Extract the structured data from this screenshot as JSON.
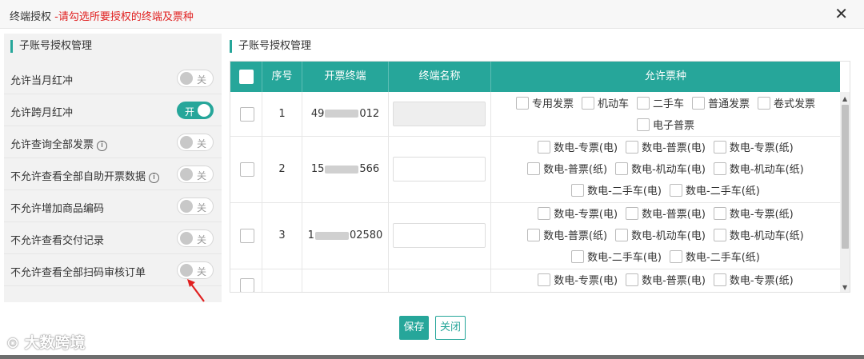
{
  "dialog": {
    "title": "终端授权",
    "hint": " -请勾选所要授权的终端及票种"
  },
  "left": {
    "section_title": "子账号授权管理",
    "options": [
      {
        "label": "允许当月红冲",
        "toggle": "关",
        "on": false
      },
      {
        "label": "允许跨月红冲",
        "toggle": "开",
        "on": true
      },
      {
        "label": "允许查询全部发票",
        "toggle": "关",
        "on": false,
        "info": "i"
      },
      {
        "label": "不允许查看全部自助开票数据",
        "toggle": "关",
        "on": false,
        "info": "i"
      },
      {
        "label": "不允许增加商品编码",
        "toggle": "关",
        "on": false
      },
      {
        "label": "不允许查看交付记录",
        "toggle": "关",
        "on": false
      },
      {
        "label": "不允许查看全部扫码审核订单",
        "toggle": "关",
        "on": false
      }
    ]
  },
  "right": {
    "section_title": "子账号授权管理"
  },
  "table": {
    "headers": {
      "seq": "序号",
      "terminal": "开票终端",
      "name": "终端名称",
      "types": "允许票种"
    },
    "rows": [
      {
        "seq": "1",
        "term_prefix": "49",
        "term_suffix": "012",
        "name_disabled": true,
        "type_lines": [
          [
            "专用发票",
            "机动车",
            "二手车",
            "普通发票",
            "卷式发票"
          ],
          [
            "电子普票"
          ]
        ]
      },
      {
        "seq": "2",
        "term_prefix": "15",
        "term_suffix": "566",
        "name_disabled": false,
        "type_lines": [
          [
            "数电-专票(电)",
            "数电-普票(电)",
            "数电-专票(纸)"
          ],
          [
            "数电-普票(纸)",
            "数电-机动车(电)",
            "数电-机动车(纸)"
          ],
          [
            "数电-二手车(电)",
            "数电-二手车(纸)"
          ]
        ]
      },
      {
        "seq": "3",
        "term_prefix": "1",
        "term_suffix": "02580",
        "name_disabled": false,
        "type_lines": [
          [
            "数电-专票(电)",
            "数电-普票(电)",
            "数电-专票(纸)"
          ],
          [
            "数电-普票(纸)",
            "数电-机动车(电)",
            "数电-机动车(纸)"
          ],
          [
            "数电-二手车(电)",
            "数电-二手车(纸)"
          ]
        ]
      },
      {
        "seq": "",
        "term_prefix": "",
        "term_suffix": "",
        "name_disabled": false,
        "type_lines": [
          [
            "数电-专票(电)",
            "数电-普票(电)",
            "数电-专票(纸)"
          ]
        ]
      }
    ]
  },
  "buttons": {
    "save": "保存",
    "close": "关闭"
  },
  "watermark": "大数跨境",
  "icons": {
    "close": "close-icon",
    "info": "info-icon",
    "arrow": "red-arrow-icon"
  },
  "colors": {
    "accent": "#26a69a",
    "hint": "#e02020",
    "arrow": "#e02020"
  }
}
